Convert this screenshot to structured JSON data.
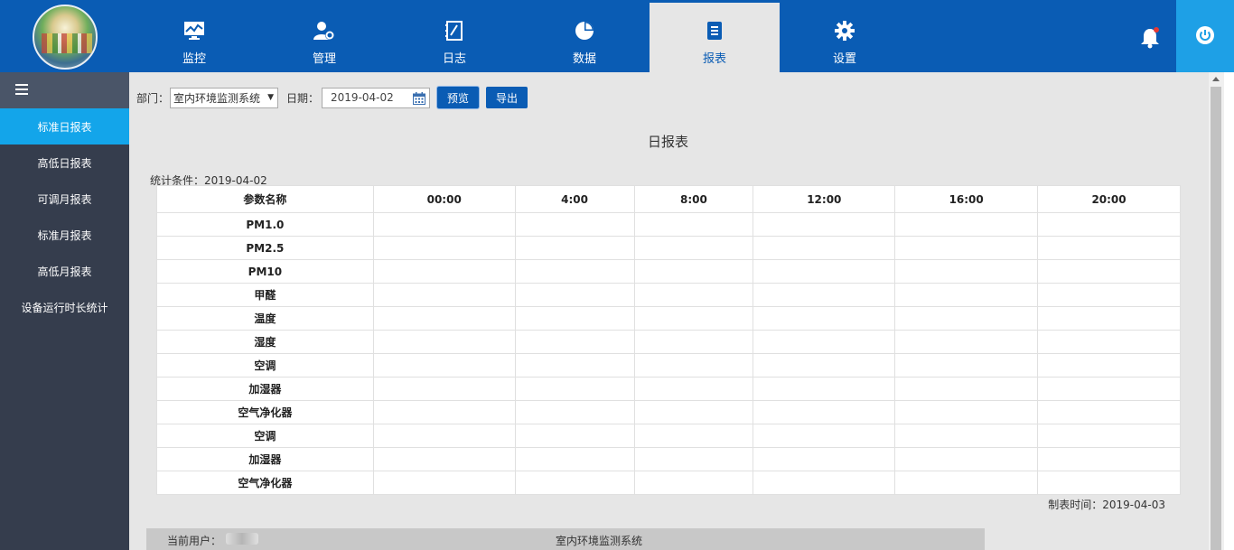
{
  "header": {
    "logo_icon": "logo-image",
    "nav": [
      {
        "label": "监控",
        "icon": "monitor-chart-icon",
        "active": false
      },
      {
        "label": "管理",
        "icon": "user-gear-icon",
        "active": false
      },
      {
        "label": "日志",
        "icon": "notebook-icon",
        "active": false
      },
      {
        "label": "数据",
        "icon": "pie-chart-icon",
        "active": false
      },
      {
        "label": "报表",
        "icon": "document-icon",
        "active": true
      },
      {
        "label": "设置",
        "icon": "gear-icon",
        "active": false
      }
    ],
    "bell_icon": "bell-icon",
    "power_icon": "power-icon",
    "accent": "#0a5cb4",
    "power_bg": "#1ea0e6"
  },
  "sidebar": {
    "toggle_icon": "hamburger-icon",
    "items": [
      {
        "label": "标准日报表",
        "active": true
      },
      {
        "label": "高低日报表",
        "active": false
      },
      {
        "label": "可调月报表",
        "active": false
      },
      {
        "label": "标准月报表",
        "active": false
      },
      {
        "label": "高低月报表",
        "active": false
      },
      {
        "label": "设备运行时长统计",
        "active": false
      }
    ],
    "active_color": "#13a5ea"
  },
  "filter": {
    "dept_label": "部门：",
    "dept_value": "室内环境监测系统",
    "date_label": "日期：",
    "date_value": "2019-04-02",
    "preview_label": "预览",
    "export_label": "导出"
  },
  "report": {
    "title": "日报表",
    "condition": "统计条件：2019-04-02",
    "columns": [
      "参数名称",
      "00:00",
      "4:00",
      "8:00",
      "12:00",
      "16:00",
      "20:00"
    ],
    "rows": [
      "PM1.0",
      "PM2.5",
      "PM10",
      "甲醛",
      "温度",
      "湿度",
      "空调",
      "加湿器",
      "空气净化器",
      "空调",
      "加湿器",
      "空气净化器"
    ],
    "made_time": "制表时间：2019-04-03"
  },
  "status": {
    "user_label": "当前用户：",
    "system_name": "室内环境监测系统"
  }
}
